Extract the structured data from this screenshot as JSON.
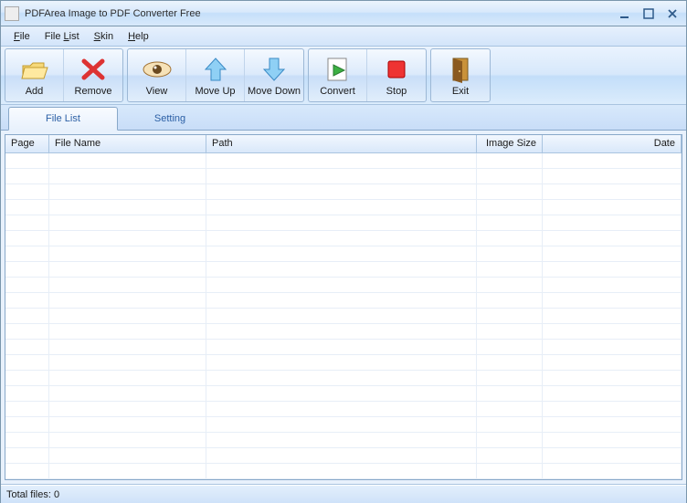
{
  "window": {
    "title": "PDFArea Image to PDF Converter Free"
  },
  "menu": {
    "file": "File",
    "filelist": "File List",
    "skin": "Skin",
    "help": "Help"
  },
  "toolbar": {
    "add": "Add",
    "remove": "Remove",
    "view": "View",
    "moveup": "Move Up",
    "movedown": "Move Down",
    "convert": "Convert",
    "stop": "Stop",
    "exit": "Exit"
  },
  "tabs": {
    "filelist": "File List",
    "setting": "Setting"
  },
  "columns": {
    "page": "Page",
    "filename": "File Name",
    "path": "Path",
    "imagesize": "Image Size",
    "date": "Date"
  },
  "status": {
    "total": "Total files: 0"
  }
}
